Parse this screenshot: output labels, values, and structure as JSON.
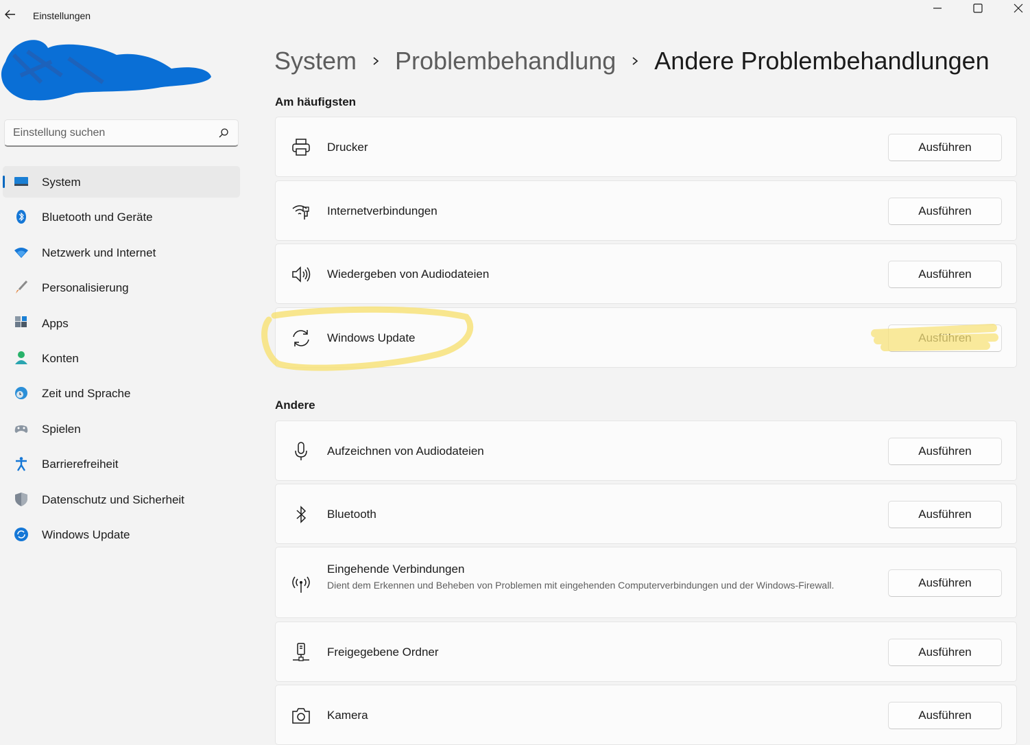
{
  "window": {
    "title": "Einstellungen"
  },
  "search": {
    "placeholder": "Einstellung suchen"
  },
  "sidebar": {
    "items": [
      {
        "label": "System",
        "icon": "system-icon",
        "active": true
      },
      {
        "label": "Bluetooth und Geräte",
        "icon": "bluetooth-icon"
      },
      {
        "label": "Netzwerk und Internet",
        "icon": "wifi-icon"
      },
      {
        "label": "Personalisierung",
        "icon": "brush-icon"
      },
      {
        "label": "Apps",
        "icon": "apps-icon"
      },
      {
        "label": "Konten",
        "icon": "account-icon"
      },
      {
        "label": "Zeit und Sprache",
        "icon": "globe-clock-icon"
      },
      {
        "label": "Spielen",
        "icon": "gamepad-icon"
      },
      {
        "label": "Barrierefreiheit",
        "icon": "accessibility-icon"
      },
      {
        "label": "Datenschutz und Sicherheit",
        "icon": "shield-icon"
      },
      {
        "label": "Windows Update",
        "icon": "windows-update-icon"
      }
    ]
  },
  "breadcrumb": {
    "items": [
      "System",
      "Problembehandlung",
      "Andere Problembehandlungen"
    ]
  },
  "sections": {
    "common": {
      "heading": "Am häufigsten",
      "items": [
        {
          "title": "Drucker",
          "icon": "printer-icon",
          "button": "Ausführen"
        },
        {
          "title": "Internetverbindungen",
          "icon": "wifi-troubleshoot-icon",
          "button": "Ausführen"
        },
        {
          "title": "Wiedergeben von Audiodateien",
          "icon": "speaker-icon",
          "button": "Ausführen"
        },
        {
          "title": "Windows Update",
          "icon": "refresh-icon",
          "button": "Ausführen"
        }
      ]
    },
    "other": {
      "heading": "Andere",
      "items": [
        {
          "title": "Aufzeichnen von Audiodateien",
          "icon": "microphone-icon",
          "button": "Ausführen"
        },
        {
          "title": "Bluetooth",
          "icon": "bluetooth-outline-icon",
          "button": "Ausführen"
        },
        {
          "title": "Eingehende Verbindungen",
          "description": "Dient dem Erkennen und Beheben von Problemen mit eingehenden Computerverbindungen und der Windows-Firewall.",
          "icon": "antenna-icon",
          "button": "Ausführen"
        },
        {
          "title": "Freigegebene Ordner",
          "icon": "network-drive-icon",
          "button": "Ausführen"
        },
        {
          "title": "Kamera",
          "icon": "camera-icon",
          "button": "Ausführen"
        }
      ]
    }
  },
  "colors": {
    "accent": "#0067c0",
    "scribble": "#0a6fd6",
    "highlighter": "#f7e27a"
  }
}
